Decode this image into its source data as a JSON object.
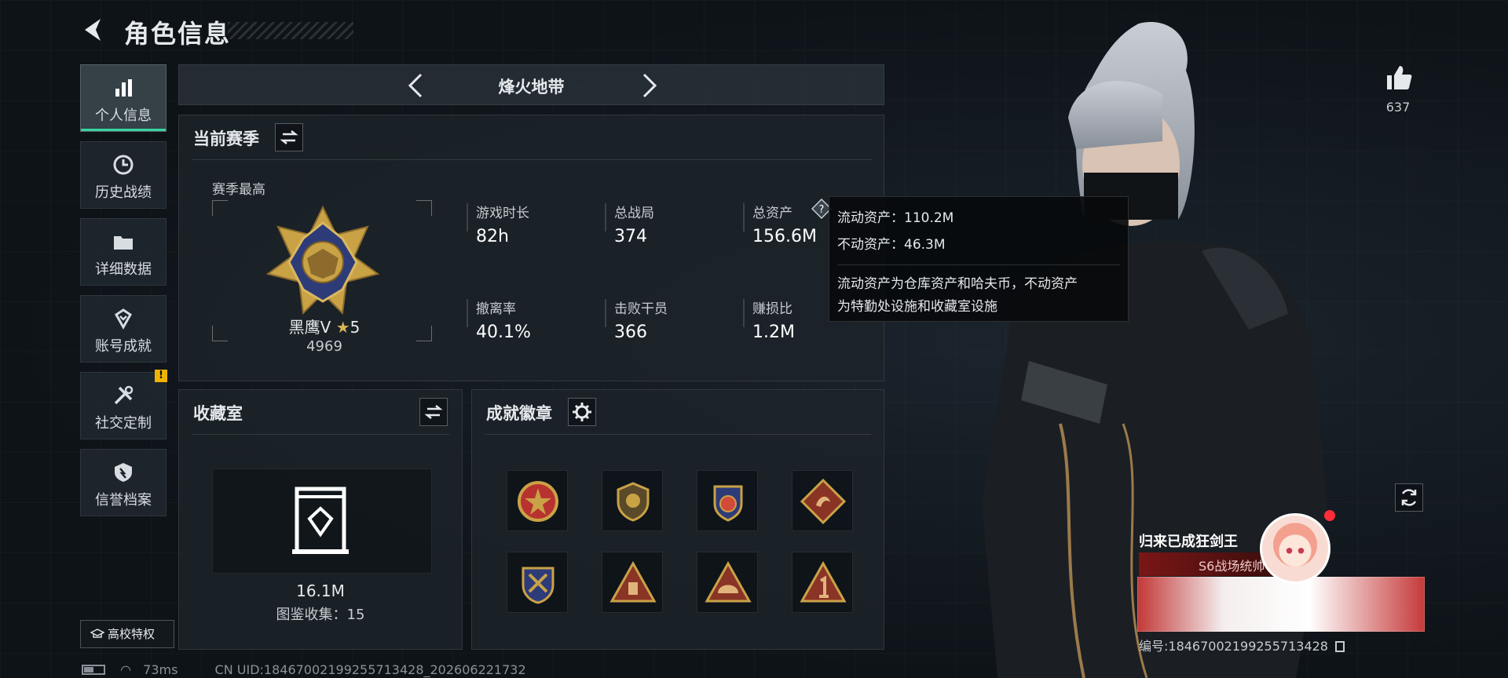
{
  "header": {
    "title": "角色信息"
  },
  "sidebar": {
    "items": [
      {
        "label": "个人信息",
        "icon": "bar-chart-icon",
        "active": true
      },
      {
        "label": "历史战绩",
        "icon": "clock-icon"
      },
      {
        "label": "详细数据",
        "icon": "folder-icon"
      },
      {
        "label": "账号成就",
        "icon": "achievement-icon"
      },
      {
        "label": "社交定制",
        "icon": "tools-icon",
        "alert": "!"
      },
      {
        "label": "信誉档案",
        "icon": "shield-icon"
      }
    ],
    "campus_label": "高校特权"
  },
  "mode": {
    "name": "烽火地带"
  },
  "season": {
    "title": "当前赛季",
    "best_label": "赛季最高",
    "rank_name": "黑鹰V",
    "rank_stars": "5",
    "rank_score": "4969",
    "stats": [
      {
        "label": "游戏时长",
        "value": "82h"
      },
      {
        "label": "总战局",
        "value": "374"
      },
      {
        "label": "总资产",
        "value": "156.6M"
      },
      {
        "label": "撤离率",
        "value": "40.1%"
      },
      {
        "label": "击败干员",
        "value": "366"
      },
      {
        "label": "赚损比",
        "value": "1.2M"
      }
    ]
  },
  "tooltip": {
    "liquid": "流动资产：110.2M",
    "fixed": "不动资产：46.3M",
    "note_line1": "流动资产为仓库资产和哈夫币，不动资产",
    "note_line2": "为特勤处设施和收藏室设施"
  },
  "collection": {
    "title": "收藏室",
    "value": "16.1M",
    "count_text": "图鉴收集：15"
  },
  "badges": {
    "title": "成就徽章",
    "count": 8
  },
  "likes": {
    "count": "637"
  },
  "card": {
    "name": "归来已成狂剑王",
    "title": "S6战场统帅",
    "id_text": "编号:18467002199255713428"
  },
  "footer": {
    "ping": "73ms",
    "uid": "CN UID:18467002199255713428_202606221732"
  },
  "colors": {
    "accent": "#38d39f",
    "gold": "#c9a246",
    "alert": "#f0b400"
  }
}
